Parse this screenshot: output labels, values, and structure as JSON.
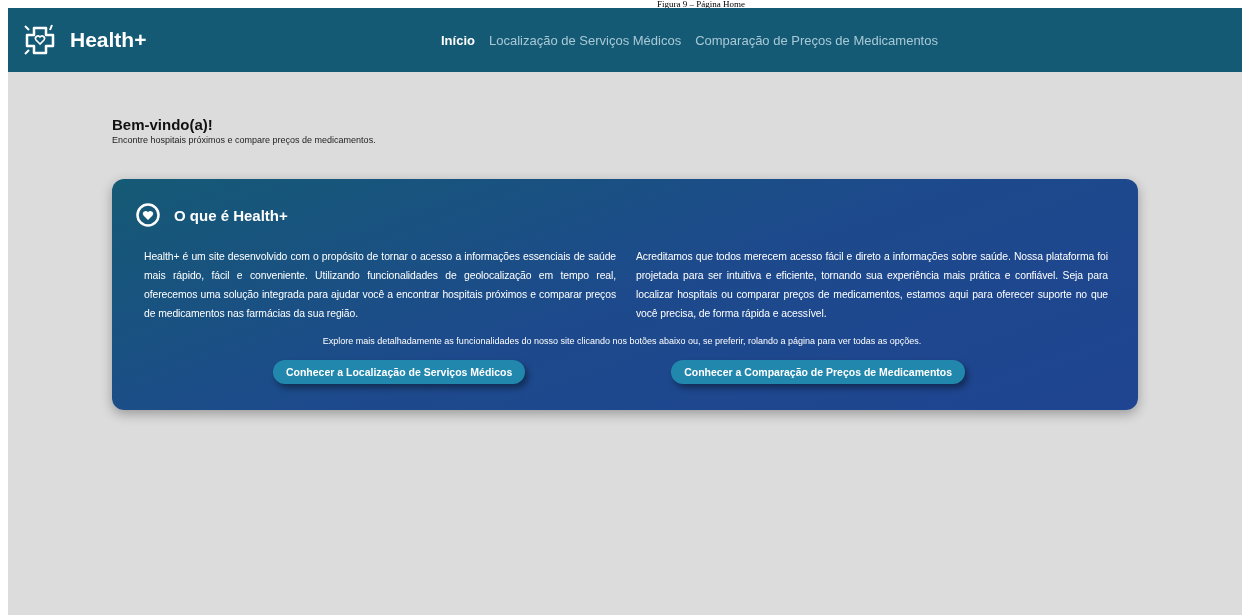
{
  "caption": "Figura 9 – Página Home",
  "navbar": {
    "brand": "Health+",
    "links": [
      {
        "label": "Início",
        "selected": true
      },
      {
        "label": "Localização de Serviços Médicos",
        "selected": false
      },
      {
        "label": "Comparação de Preços de Medicamentos",
        "selected": false
      }
    ]
  },
  "welcome": {
    "title": "Bem-vindo(a)!",
    "subtitle": "Encontre hospitais próximos e compare preços de medicamentos."
  },
  "card": {
    "title": "O que é Health+",
    "paragraphs": [
      "Health+ é um site desenvolvido com o propósito de tornar o acesso a informações essenciais de saúde mais rápido, fácil e conveniente. Utilizando funcionalidades de geolocalização em tempo real, oferecemos uma solução integrada para ajudar você a encontrar hospitais próximos e comparar preços de medicamentos nas farmácias da sua região.",
      "Acreditamos que todos merecem acesso fácil e direto a informações sobre saúde. Nossa plataforma foi projetada para ser intuitiva e eficiente, tornando sua experiência mais prática e confiável. Seja para localizar hospitais ou comparar preços de medicamentos, estamos aqui para oferecer suporte no que você precisa, de forma rápida e acessível."
    ],
    "note": "Explore mais detalhadamente as funcionalidades do nosso site clicando nos botões abaixo ou, se preferir, rolando a página para ver todas as opções.",
    "buttons": [
      "Conhecer a Localização de Serviços Médicos",
      "Conhecer a Comparação de Preços de Medicamentos"
    ]
  }
}
